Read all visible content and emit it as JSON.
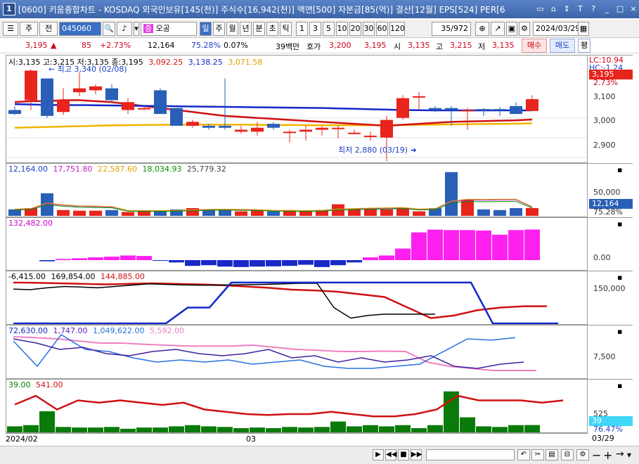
{
  "window": {
    "number": "1",
    "title": "[0600] 키움종합차트 - KOSDAQ 외국인보유[145(천)] 주식수[16,942(천)] 액면[500] 자본금[85(억)] 결산[12월] EPS[524] PER[6"
  },
  "toolbar": {
    "period_label": "주",
    "all_label": "전",
    "code": "045060",
    "stock_name": "오공",
    "timeframes": [
      "일",
      "주",
      "월",
      "년",
      "분",
      "초",
      "틱"
    ],
    "selected_timeframe": "일",
    "intervals": [
      "1",
      "3",
      "5",
      "10",
      "20",
      "30",
      "60",
      "120"
    ],
    "count": "35/972",
    "date": "2024/03/29"
  },
  "quote": {
    "price": "3,195",
    "change": "85",
    "change_pct": "+2.73%",
    "volume": "12,164",
    "ratio": "75.28%",
    "ratio2": "0.07%",
    "amount": "39백만",
    "ask_label": "호가",
    "ask": "3,200",
    "bid": "3,195",
    "open_label": "시",
    "open": "3,135",
    "high_label": "고",
    "high": "3,215",
    "low_label": "저",
    "low": "3,135",
    "buy_label": "매수",
    "sell_label": "매도",
    "eval_label": "평"
  },
  "price_pane": {
    "legend": {
      "ohlc": "시:3,135 고:3,215 저:3,135 종:3,195",
      "ma1": "3,092.25",
      "ma2": "3,138.25",
      "ma3": "3,071.58"
    },
    "high_note": "최고 3,340 (02/08)",
    "low_note": "최저 2,880 (03/19)",
    "current_label": "3,195",
    "current_pct": "2.73%",
    "lc_label": "LC:10.94",
    "hc_label": "HC:-1.24",
    "ticks": [
      "3,100",
      "3,000",
      "2,900"
    ],
    "colors": {
      "up": "#e8241c",
      "down": "#2a5fb7",
      "ma_short": "#d01010",
      "ma_mid": "#1428c8",
      "ma_long": "#f0b400"
    }
  },
  "volume_pane": {
    "legend": [
      "12,164.00",
      "17,751.80",
      "22,587.60",
      "18,034.93",
      "25,779.32"
    ],
    "tick": "50,000",
    "current_label": "12,164",
    "current_pct": "75.28%"
  },
  "inst_pane": {
    "legend": "132,482.00",
    "tick": "0.00"
  },
  "foreign_pane": {
    "legend": [
      "-6,415.00",
      "169,854.00",
      "144,885.00"
    ],
    "tick": "150,000"
  },
  "osc_pane": {
    "legend": [
      "72,630.00",
      "1,747.00",
      "1,049,622.00",
      "5,592.00"
    ],
    "tick": "7,500"
  },
  "rsi_pane": {
    "legend": [
      "39.00",
      "541.00"
    ],
    "tick": "525",
    "current_label": "39",
    "current_pct": "76.47%"
  },
  "dates": {
    "start": "2024/02",
    "month": "03",
    "end": "03/29"
  },
  "chart_data": {
    "type": "candlestick",
    "candles": [
      {
        "o": 3140,
        "h": 3160,
        "l": 3115,
        "c": 3120
      },
      {
        "o": 3190,
        "h": 3345,
        "l": 3140,
        "c": 3340
      },
      {
        "o": 3300,
        "h": 3200,
        "l": 3100,
        "c": 3110
      },
      {
        "o": 3130,
        "h": 3250,
        "l": 3115,
        "c": 3190
      },
      {
        "o": 3230,
        "h": 3330,
        "l": 3210,
        "c": 3250
      },
      {
        "o": 3240,
        "h": 3270,
        "l": 3220,
        "c": 3260
      },
      {
        "o": 3250,
        "h": 3270,
        "l": 3180,
        "c": 3190
      },
      {
        "o": 3140,
        "h": 3200,
        "l": 3120,
        "c": 3180
      },
      {
        "o": 3150,
        "h": 3160,
        "l": 3140,
        "c": 3150
      },
      {
        "o": 3240,
        "h": 3250,
        "l": 3120,
        "c": 3120
      },
      {
        "o": 3150,
        "h": 3150,
        "l": 3060,
        "c": 3060
      },
      {
        "o": 3060,
        "h": 3090,
        "l": 3050,
        "c": 3080
      },
      {
        "o": 3060,
        "h": 3070,
        "l": 3040,
        "c": 3050
      },
      {
        "o": 3060,
        "h": 3300,
        "l": 3040,
        "c": 3050
      },
      {
        "o": 3030,
        "h": 3060,
        "l": 3020,
        "c": 3040
      },
      {
        "o": 3030,
        "h": 3080,
        "l": 3010,
        "c": 3050
      },
      {
        "o": 3070,
        "h": 3080,
        "l": 3040,
        "c": 3050
      },
      {
        "o": 3030,
        "h": 3040,
        "l": 2975,
        "c": 3030
      },
      {
        "o": 3030,
        "h": 3060,
        "l": 2985,
        "c": 3040
      },
      {
        "o": 3040,
        "h": 3060,
        "l": 3010,
        "c": 3050
      },
      {
        "o": 3050,
        "h": 3060,
        "l": 2995,
        "c": 3050
      },
      {
        "o": 3020,
        "h": 3040,
        "l": 3020,
        "c": 3025
      },
      {
        "o": 3010,
        "h": 3030,
        "l": 2985,
        "c": 3010
      },
      {
        "o": 3000,
        "h": 3110,
        "l": 2880,
        "c": 3090
      },
      {
        "o": 3100,
        "h": 3215,
        "l": 3090,
        "c": 3200
      },
      {
        "o": 3210,
        "h": 3230,
        "l": 3140,
        "c": 3210
      },
      {
        "o": 3150,
        "h": 3160,
        "l": 3130,
        "c": 3140
      },
      {
        "o": 3150,
        "h": 3160,
        "l": 3060,
        "c": 3140
      },
      {
        "o": 3140,
        "h": 3150,
        "l": 3040,
        "c": 3140
      },
      {
        "o": 3145,
        "h": 3150,
        "l": 3110,
        "c": 3140
      },
      {
        "o": 3145,
        "h": 3155,
        "l": 3110,
        "c": 3140
      },
      {
        "o": 3160,
        "h": 3180,
        "l": 3125,
        "c": 3120
      },
      {
        "o": 3135,
        "h": 3215,
        "l": 3135,
        "c": 3195
      }
    ],
    "ma_short": [
      3180,
      3185,
      3185,
      3190,
      3190,
      3185,
      3180,
      3170,
      3160,
      3150,
      3140,
      3130,
      3120,
      3110,
      3105,
      3100,
      3095,
      3090,
      3085,
      3080,
      3075,
      3070,
      3065,
      3060,
      3065,
      3070,
      3075,
      3080,
      3082,
      3084,
      3086,
      3088,
      3092
    ],
    "ma_mid": [
      3170,
      3168,
      3166,
      3165,
      3165,
      3164,
      3163,
      3162,
      3161,
      3160,
      3159,
      3158,
      3157,
      3156,
      3155,
      3154,
      3153,
      3152,
      3151,
      3150,
      3148,
      3146,
      3144,
      3142,
      3140,
      3139,
      3138,
      3138,
      3138,
      3138,
      3138,
      3138,
      3138
    ],
    "ma_long": [
      3050,
      3052,
      3054,
      3056,
      3058,
      3060,
      3062,
      3063,
      3064,
      3065,
      3066,
      3066,
      3066,
      3066,
      3066,
      3065,
      3064,
      3064,
      3063,
      3063,
      3063,
      3063,
      3063,
      3063,
      3064,
      3065,
      3066,
      3067,
      3068,
      3069,
      3070,
      3071,
      3072
    ],
    "volumes": [
      10000,
      12000,
      35000,
      9000,
      8000,
      8000,
      9000,
      6000,
      8000,
      8000,
      10000,
      12000,
      10000,
      9000,
      7000,
      8000,
      7000,
      9000,
      8000,
      9000,
      18000,
      10000,
      12000,
      10000,
      12000,
      7000,
      12000,
      68000,
      25000,
      10000,
      9000,
      12000,
      12164
    ],
    "inst_values": [
      -5000,
      5000,
      8000,
      12000,
      15000,
      20000,
      18000,
      -3000,
      -10000,
      -25000,
      -22000,
      -28000,
      -30000,
      -28000,
      -27000,
      -25000,
      -20000,
      -30000,
      -22000,
      -10000,
      12000,
      20000,
      50000,
      120000,
      132000,
      130000,
      130000,
      128000,
      110000,
      130000,
      132482
    ],
    "foreign_lines": {
      "black": [
        130,
        128,
        135,
        140,
        138,
        135,
        140,
        145,
        150,
        148,
        146,
        145,
        145,
        146,
        147,
        148,
        150,
        152,
        152,
        60,
        20,
        30,
        35,
        35,
        35,
        35
      ],
      "blue": [
        0,
        0,
        0,
        0,
        0,
        0,
        0,
        0,
        60,
        60,
        155,
        155,
        155,
        155,
        155,
        155,
        155,
        155,
        155,
        155,
        155,
        155,
        0,
        0,
        0,
        0
      ],
      "red": [
        155,
        154,
        152,
        150,
        148,
        150,
        152,
        150,
        148,
        145,
        140,
        135,
        128,
        125,
        120,
        110,
        100,
        60,
        20,
        30,
        50,
        60,
        65,
        65
      ]
    },
    "rsi_line": [
      541,
      560,
      530,
      550,
      545,
      550,
      545,
      540,
      545,
      530,
      525,
      520,
      518,
      520,
      520,
      525,
      520,
      515,
      515,
      520,
      530,
      560,
      550,
      550,
      550,
      545,
      550
    ]
  }
}
